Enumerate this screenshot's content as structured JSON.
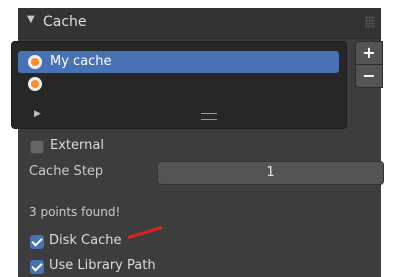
{
  "panel": {
    "title": "Cache",
    "collapse_icon": "triangle-down-icon"
  },
  "cache_list": {
    "items": [
      {
        "label": "My cache",
        "icon": "cache-icon",
        "selected": true
      },
      {
        "label": "",
        "icon": "cache-icon",
        "selected": false
      }
    ],
    "expand_icon": "triangle-right-icon",
    "resize_icon": "resize-handle-icon"
  },
  "side_buttons": {
    "add": "+",
    "remove": "−"
  },
  "options": {
    "external_label": "External",
    "external_checked": false,
    "cache_step_label": "Cache Step",
    "cache_step_value": "1",
    "points_found": "3 points found!",
    "disk_cache_label": "Disk Cache",
    "disk_cache_checked": true,
    "use_library_path_label": "Use Library Path",
    "use_library_path_checked": true
  },
  "colors": {
    "panel_bg": "#3d3d3d",
    "accent": "#4772b3",
    "annotation": "#e0201c"
  }
}
